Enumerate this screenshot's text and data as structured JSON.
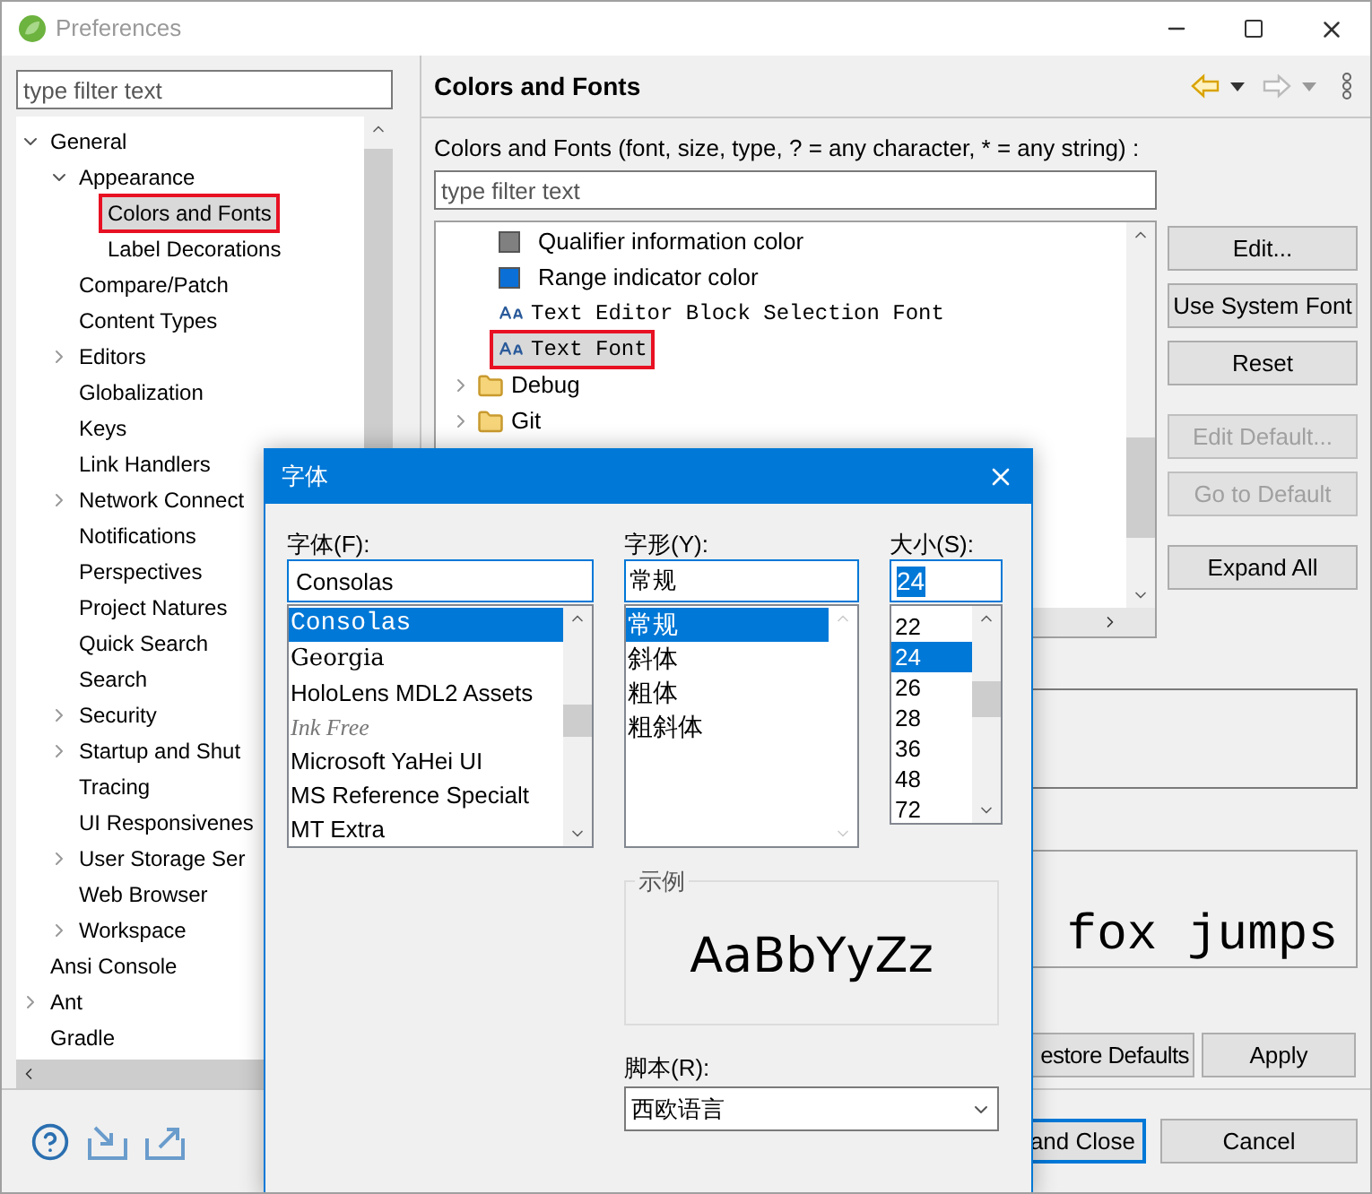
{
  "window": {
    "title": "Preferences"
  },
  "sidebar": {
    "filter_placeholder": "type filter text",
    "tree": [
      {
        "label": "General",
        "expanded": true,
        "selected": false,
        "children": [
          {
            "label": "Appearance",
            "expanded": true,
            "selected": false,
            "children": [
              {
                "label": "Colors and Fonts",
                "selected": true
              },
              {
                "label": "Label Decorations",
                "selected": false
              }
            ]
          },
          {
            "label": "Compare/Patch",
            "selected": false
          },
          {
            "label": "Content Types",
            "selected": false
          },
          {
            "label": "Editors",
            "expanded": false,
            "selected": false
          },
          {
            "label": "Globalization",
            "selected": false
          },
          {
            "label": "Keys",
            "selected": false
          },
          {
            "label": "Link Handlers",
            "selected": false
          },
          {
            "label": "Network Connect",
            "expanded": false,
            "selected": false
          },
          {
            "label": "Notifications",
            "selected": false
          },
          {
            "label": "Perspectives",
            "selected": false
          },
          {
            "label": "Project Natures",
            "selected": false
          },
          {
            "label": "Quick Search",
            "selected": false
          },
          {
            "label": "Search",
            "selected": false
          },
          {
            "label": "Security",
            "expanded": false,
            "selected": false
          },
          {
            "label": "Startup and Shut",
            "expanded": false,
            "selected": false
          },
          {
            "label": "Tracing",
            "selected": false
          },
          {
            "label": "UI Responsivenes",
            "selected": false
          },
          {
            "label": "User Storage Ser",
            "expanded": false,
            "selected": false
          },
          {
            "label": "Web Browser",
            "selected": false
          },
          {
            "label": "Workspace",
            "expanded": false,
            "selected": false
          }
        ]
      },
      {
        "label": "Ansi Console",
        "selected": false
      },
      {
        "label": "Ant",
        "expanded": false,
        "selected": false
      },
      {
        "label": "Gradle",
        "selected": false
      }
    ]
  },
  "page": {
    "title": "Colors and Fonts",
    "description": "Colors and Fonts (font, size, type, ? = any character, * = any string) :",
    "filter_placeholder": "type filter text",
    "items": [
      {
        "kind": "color",
        "label": "Qualifier information color",
        "color": "#808080",
        "selected": false
      },
      {
        "kind": "color",
        "label": "Range indicator color",
        "color": "#0a6fd6",
        "selected": false
      },
      {
        "kind": "font",
        "label": "Text Editor Block Selection Font",
        "selected": false
      },
      {
        "kind": "font",
        "label": "Text Font",
        "selected": true
      },
      {
        "kind": "category",
        "label": "Debug",
        "expanded": false,
        "selected": false
      },
      {
        "kind": "category",
        "label": "Git",
        "expanded": false,
        "selected": false
      }
    ],
    "side_buttons": [
      {
        "label": "Edit...",
        "disabled": false
      },
      {
        "label": "Use System Font",
        "disabled": false
      },
      {
        "label": "Reset",
        "disabled": false
      },
      {
        "label": "Edit Default...",
        "disabled": true
      },
      {
        "label": "Go to Default",
        "disabled": true
      },
      {
        "label": "Expand All",
        "disabled": false
      }
    ],
    "preview_text": "fox jumps",
    "buttons": [
      "estore Defaults",
      "Apply"
    ]
  },
  "footer": {
    "buttons": [
      {
        "label": "and Close",
        "default": true
      },
      {
        "label": "Cancel",
        "default": false
      }
    ]
  },
  "font_dialog": {
    "title": "字体",
    "font": {
      "label": "字体(F):",
      "value": "Consolas",
      "options": [
        {
          "label": "Consolas",
          "kind": "mono",
          "selected": true
        },
        {
          "label": "Georgia",
          "kind": "serif",
          "selected": false
        },
        {
          "label": "HoloLens MDL2 Assets",
          "kind": "sans",
          "selected": false
        },
        {
          "label": "Ink Free",
          "kind": "script",
          "selected": false
        },
        {
          "label": "Microsoft YaHei UI",
          "kind": "sans",
          "selected": false
        },
        {
          "label": "MS Reference Specialt",
          "kind": "sans",
          "selected": false
        },
        {
          "label": "MT Extra",
          "kind": "sans",
          "selected": false
        }
      ]
    },
    "style": {
      "label": "字形(Y):",
      "value": "常规",
      "options": [
        {
          "label": "常规",
          "selected": true
        },
        {
          "label": "斜体",
          "selected": false
        },
        {
          "label": "粗体",
          "selected": false
        },
        {
          "label": "粗斜体",
          "selected": false
        }
      ]
    },
    "size": {
      "label": "大小(S):",
      "value": "24",
      "options": [
        {
          "label": "22",
          "selected": false
        },
        {
          "label": "24",
          "selected": true
        },
        {
          "label": "26",
          "selected": false
        },
        {
          "label": "28",
          "selected": false
        },
        {
          "label": "36",
          "selected": false
        },
        {
          "label": "48",
          "selected": false
        },
        {
          "label": "72",
          "selected": false
        }
      ]
    },
    "sample": {
      "label": "示例",
      "text": "AaBbYyZz"
    },
    "script": {
      "label": "脚本(R):",
      "value": "西欧语言"
    }
  }
}
